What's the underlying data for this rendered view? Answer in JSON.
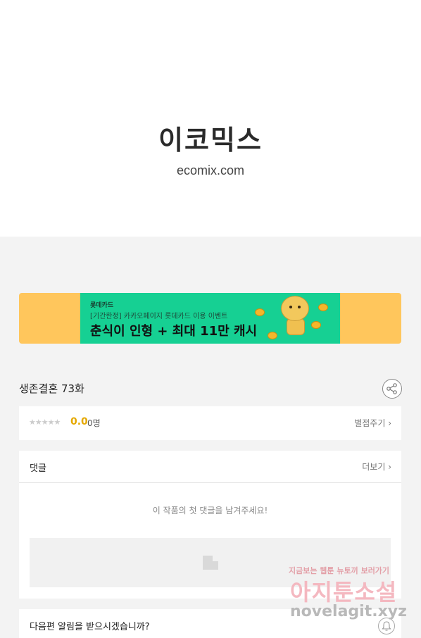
{
  "logo": {
    "korean": "이코믹스",
    "url": "ecomix.com"
  },
  "banner": {
    "brand": "롯데카드",
    "subtitle": "[기간한정] 카카오페이지 롯데카드 이용 이벤트",
    "headline": "춘식이 인형 + 최대 11만 캐시",
    "side_color": "#ffc65c",
    "center_color": "#16d093"
  },
  "episode": {
    "title": "생존결혼 73화",
    "share_icon": "share-icon"
  },
  "rating": {
    "stars": "★★★★★",
    "score": "0.0",
    "count": "0명",
    "rate_link": "별점주기 ›",
    "score_color": "#e5a800"
  },
  "comments": {
    "header": "댓글",
    "more": "더보기 ›",
    "empty_message": "이 작품의 첫 댓글을 남겨주세요!"
  },
  "notify": {
    "text": "다음편 알림을 받으시겠습니까?",
    "bell_icon": "bell-icon"
  },
  "watermark": {
    "top": "지금보는 웹툰 뉴토끼 보러가기",
    "middle": "아지툰소설",
    "bottom": "novelagit.xyz"
  }
}
